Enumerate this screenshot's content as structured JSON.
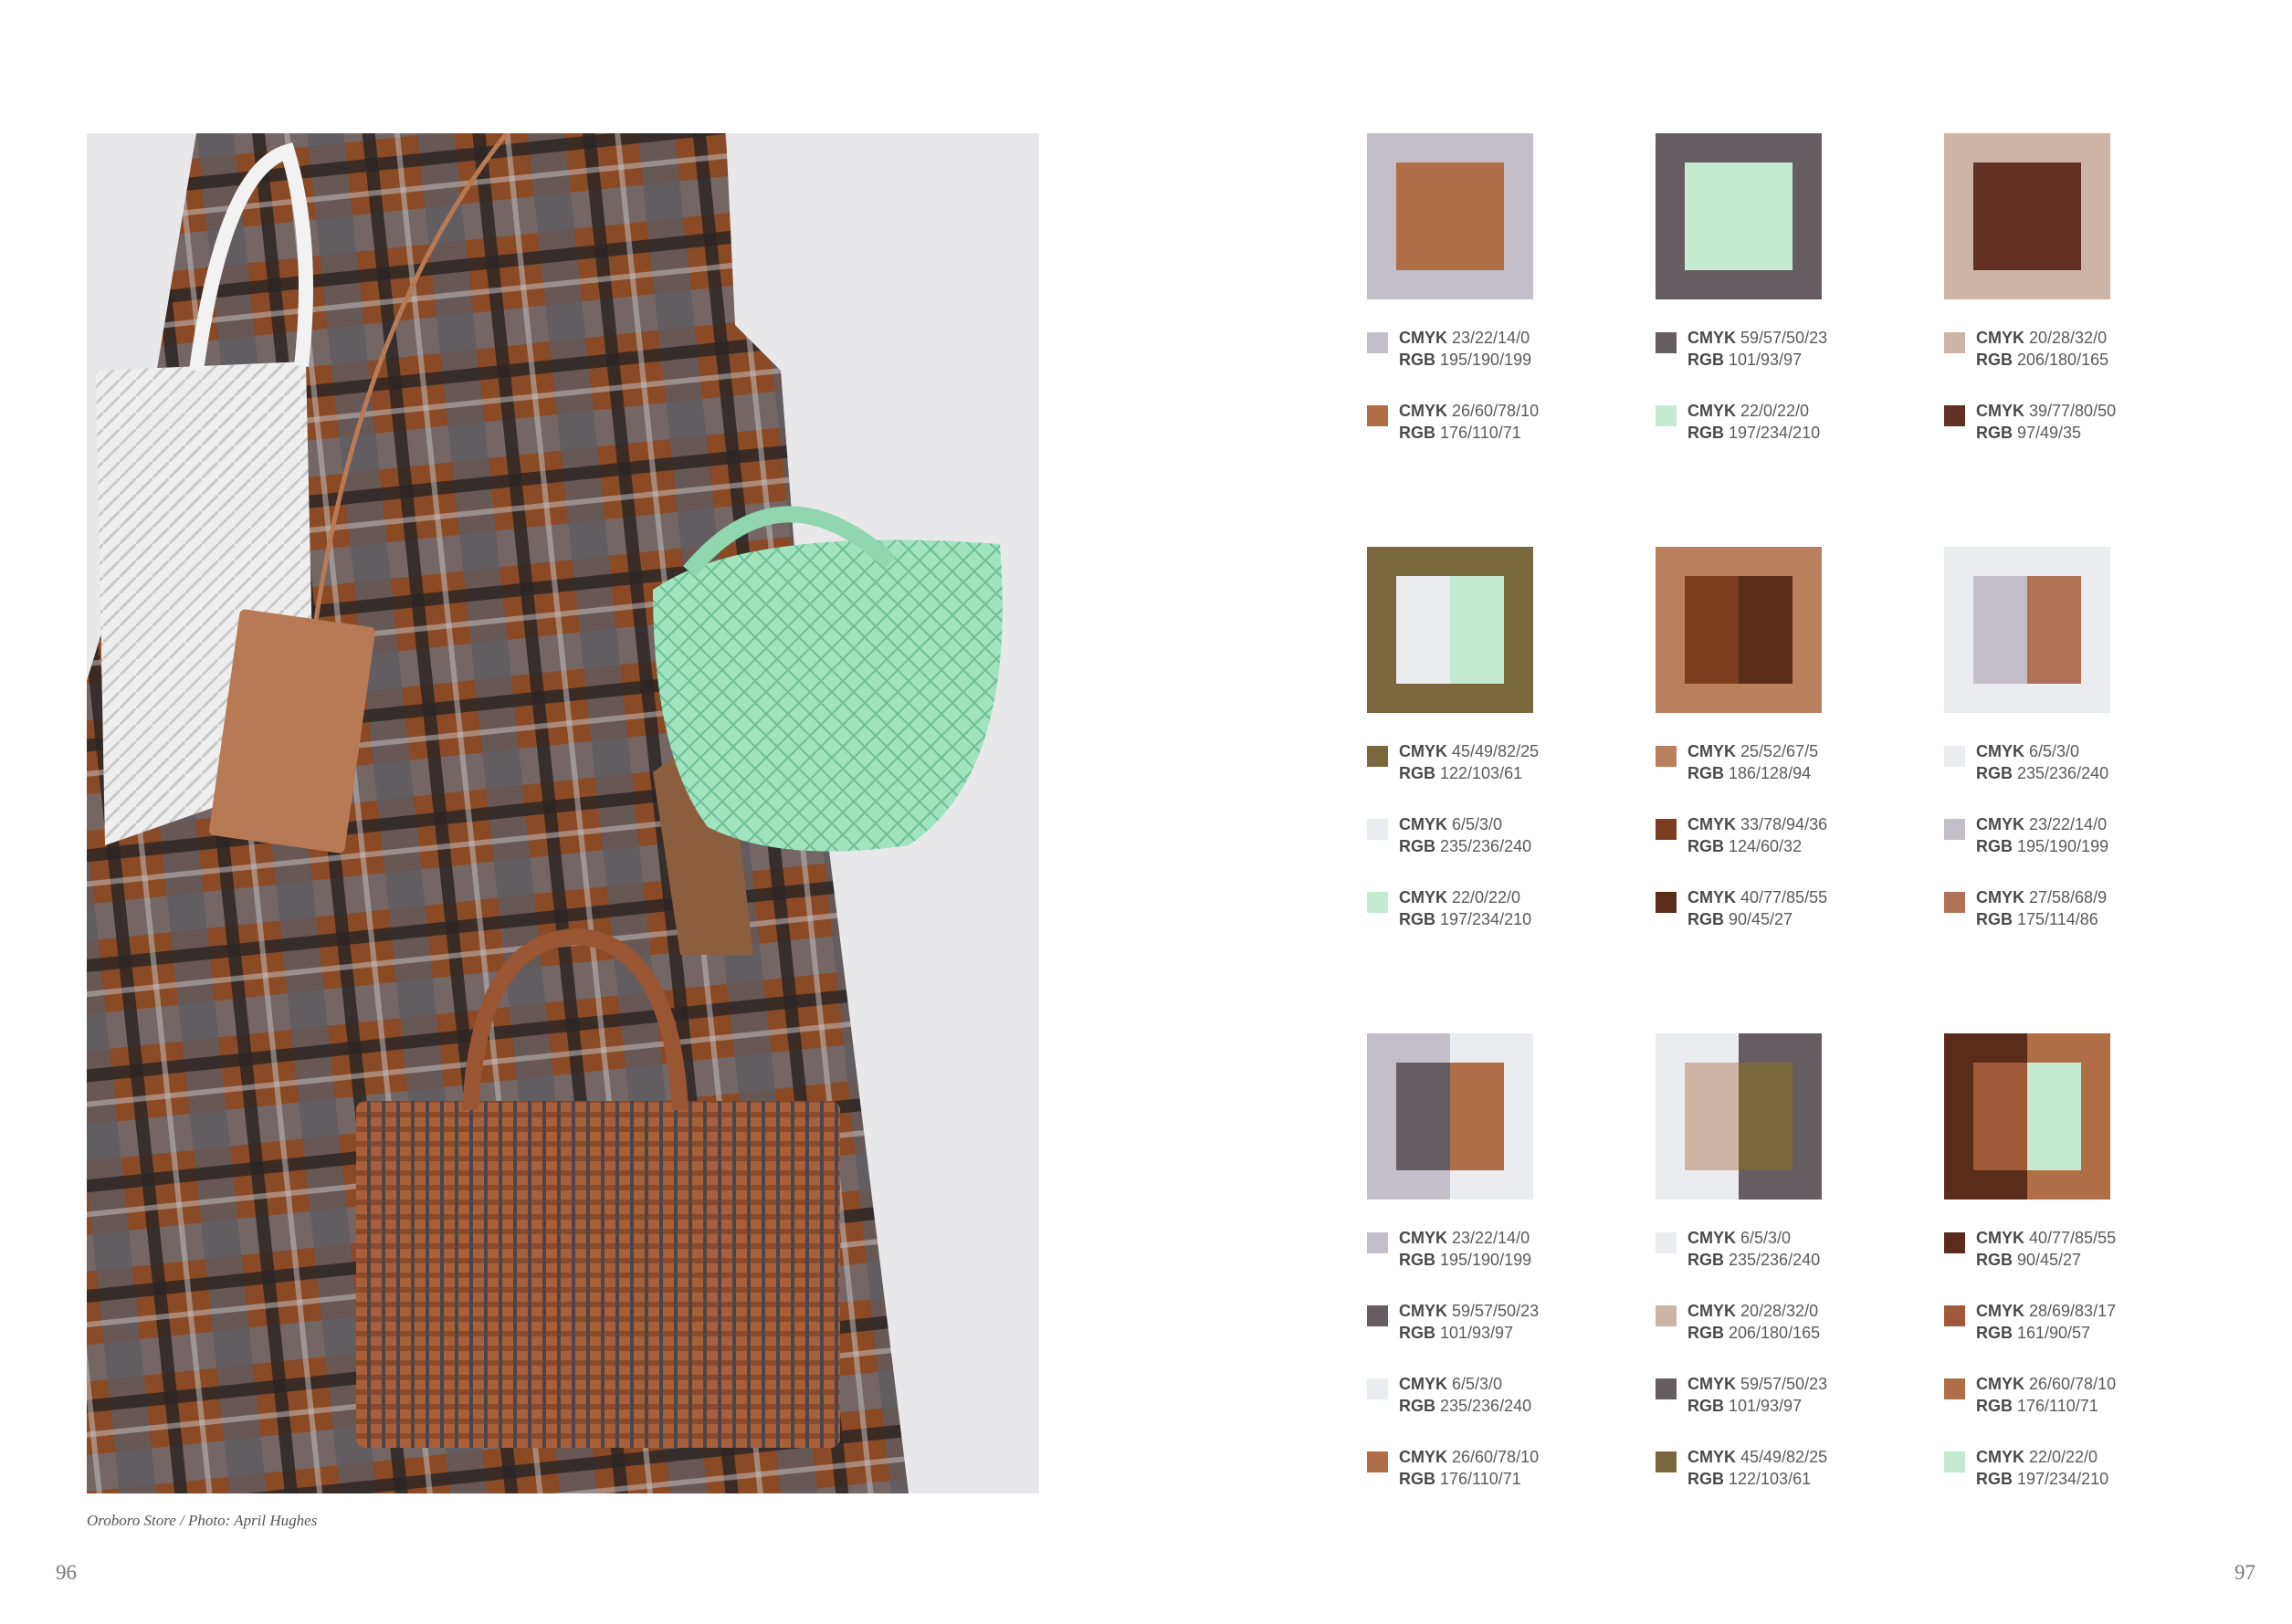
{
  "caption": "Oroboro Store / Photo: April Hughes",
  "page_numbers": {
    "left": "96",
    "right": "97"
  },
  "labels": {
    "cmyk": "CMYK",
    "rgb": "RGB"
  },
  "palettes": [
    {
      "swatches": [
        {
          "hex": "#c3bec7",
          "cmyk": "23/22/14/0",
          "rgb": "195/190/199"
        },
        {
          "hex": "#b06e47",
          "cmyk": "26/60/78/10",
          "rgb": "176/110/71"
        }
      ]
    },
    {
      "swatches": [
        {
          "hex": "#655d61",
          "cmyk": "59/57/50/23",
          "rgb": "101/93/97"
        },
        {
          "hex": "#c5ead2",
          "cmyk": "22/0/22/0",
          "rgb": "197/234/210"
        }
      ]
    },
    {
      "swatches": [
        {
          "hex": "#ceb4a5",
          "cmyk": "20/28/32/0",
          "rgb": "206/180/165"
        },
        {
          "hex": "#613123",
          "cmyk": "39/77/80/50",
          "rgb": "97/49/35"
        }
      ]
    },
    {
      "swatches": [
        {
          "hex": "#7a673d",
          "cmyk": "45/49/82/25",
          "rgb": "122/103/61"
        },
        {
          "hex": "#ebecf0",
          "cmyk": "6/5/3/0",
          "rgb": "235/236/240"
        },
        {
          "hex": "#c5ead2",
          "cmyk": "22/0/22/0",
          "rgb": "197/234/210"
        }
      ]
    },
    {
      "swatches": [
        {
          "hex": "#ba805e",
          "cmyk": "25/52/67/5",
          "rgb": "186/128/94"
        },
        {
          "hex": "#7c3c20",
          "cmyk": "33/78/94/36",
          "rgb": "124/60/32"
        },
        {
          "hex": "#5a2d1b",
          "cmyk": "40/77/85/55",
          "rgb": "90/45/27"
        }
      ]
    },
    {
      "swatches": [
        {
          "hex": "#ebecf0",
          "cmyk": "6/5/3/0",
          "rgb": "235/236/240"
        },
        {
          "hex": "#c3bec7",
          "cmyk": "23/22/14/0",
          "rgb": "195/190/199"
        },
        {
          "hex": "#af7256",
          "cmyk": "27/58/68/9",
          "rgb": "175/114/86"
        }
      ]
    },
    {
      "swatches": [
        {
          "hex": "#c3bec7",
          "cmyk": "23/22/14/0",
          "rgb": "195/190/199"
        },
        {
          "hex": "#655d61",
          "cmyk": "59/57/50/23",
          "rgb": "101/93/97"
        },
        {
          "hex": "#ebecf0",
          "cmyk": "6/5/3/0",
          "rgb": "235/236/240"
        },
        {
          "hex": "#b06e47",
          "cmyk": "26/60/78/10",
          "rgb": "176/110/71"
        }
      ]
    },
    {
      "swatches": [
        {
          "hex": "#ebecf0",
          "cmyk": "6/5/3/0",
          "rgb": "235/236/240"
        },
        {
          "hex": "#ceb4a5",
          "cmyk": "20/28/32/0",
          "rgb": "206/180/165"
        },
        {
          "hex": "#655d61",
          "cmyk": "59/57/50/23",
          "rgb": "101/93/97"
        },
        {
          "hex": "#7a673d",
          "cmyk": "45/49/82/25",
          "rgb": "122/103/61"
        }
      ]
    },
    {
      "swatches": [
        {
          "hex": "#5a2d1b",
          "cmyk": "40/77/85/55",
          "rgb": "90/45/27"
        },
        {
          "hex": "#a15a39",
          "cmyk": "28/69/83/17",
          "rgb": "161/90/57"
        },
        {
          "hex": "#b06e47",
          "cmyk": "26/60/78/10",
          "rgb": "176/110/71"
        },
        {
          "hex": "#c5ead2",
          "cmyk": "22/0/22/0",
          "rgb": "197/234/210"
        }
      ]
    }
  ]
}
